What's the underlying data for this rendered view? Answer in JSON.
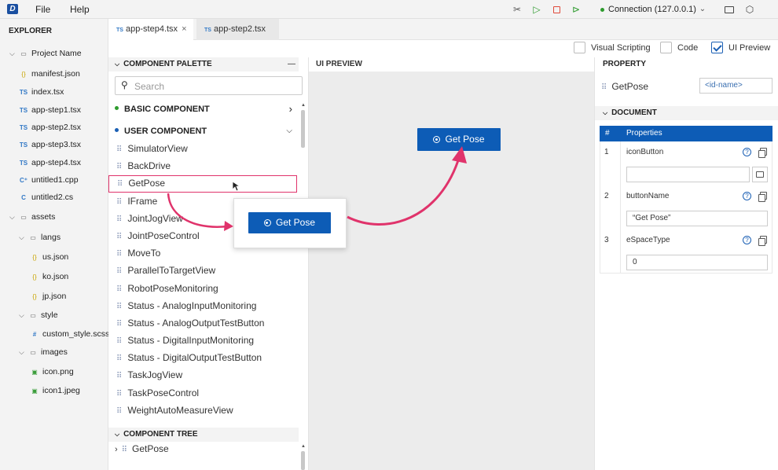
{
  "menubar": {
    "logo": "D",
    "file": "File",
    "help": "Help",
    "connection": "Connection (127.0.0.1)"
  },
  "explorer": {
    "title": "EXPLORER",
    "project": "Project Name",
    "items": [
      {
        "label": "manifest.json",
        "type": "json"
      },
      {
        "label": "index.tsx",
        "type": "ts"
      },
      {
        "label": "app-step1.tsx",
        "type": "ts"
      },
      {
        "label": "app-step2.tsx",
        "type": "ts"
      },
      {
        "label": "app-step3.tsx",
        "type": "ts"
      },
      {
        "label": "app-step4.tsx",
        "type": "ts"
      },
      {
        "label": "untitled1.cpp",
        "type": "cpp"
      },
      {
        "label": "untitled2.cs",
        "type": "cs"
      }
    ],
    "assets": "assets",
    "langs": "langs",
    "lang_files": [
      "us.json",
      "ko.json",
      "jp.json"
    ],
    "style": "style",
    "style_file": "custom_style.scss",
    "images": "images",
    "image_files": [
      "icon.png",
      "icon1.jpeg"
    ]
  },
  "tabs": [
    {
      "icon": "TS",
      "label": "app-step4.tsx",
      "close": "×"
    },
    {
      "icon": "TS",
      "label": "app-step2.tsx"
    }
  ],
  "options": {
    "visual_scripting": "Visual Scripting",
    "code": "Code",
    "ui_preview": "UI Preview"
  },
  "palette": {
    "title": "COMPONENT PALETTE",
    "collapse": "—",
    "search_placeholder": "Search",
    "basic": "BASIC COMPONENT",
    "user": "USER COMPONENT",
    "components": [
      "SimulatorView",
      "BackDrive",
      "GetPose",
      "IFrame",
      "JointJogView",
      "JointPoseControl",
      "MoveTo",
      "ParallelToTargetView",
      "RobotPoseMonitoring",
      "Status - AnalogInputMonitoring",
      "Status - AnalogOutputTestButton",
      "Status - DigitalInputMonitoring",
      "Status - DigitalOutputTestButton",
      "TaskJogView",
      "TaskPoseControl",
      "WeightAutoMeasureView"
    ],
    "tree_title": "COMPONENT TREE",
    "tree_item": "GetPose"
  },
  "preview": {
    "title": "UI PREVIEW",
    "button_label": "Get Pose",
    "drag_label": "Get Pose"
  },
  "property": {
    "title": "PROPERTY",
    "name": "GetPose",
    "id_placeholder": "<id-name>",
    "document_title": "DOCUMENT",
    "col_num": "#",
    "col_props": "Properties",
    "rows": [
      {
        "num": "1",
        "name": "iconButton",
        "value": ""
      },
      {
        "num": "2",
        "name": "buttonName",
        "value": "“Get Pose”"
      },
      {
        "num": "3",
        "name": "eSpaceType",
        "value": "0"
      }
    ]
  },
  "colors": {
    "accent": "#0d5cb6",
    "highlight": "#e0336b",
    "running": "#2e9b2e",
    "stop": "#e04a3a"
  }
}
